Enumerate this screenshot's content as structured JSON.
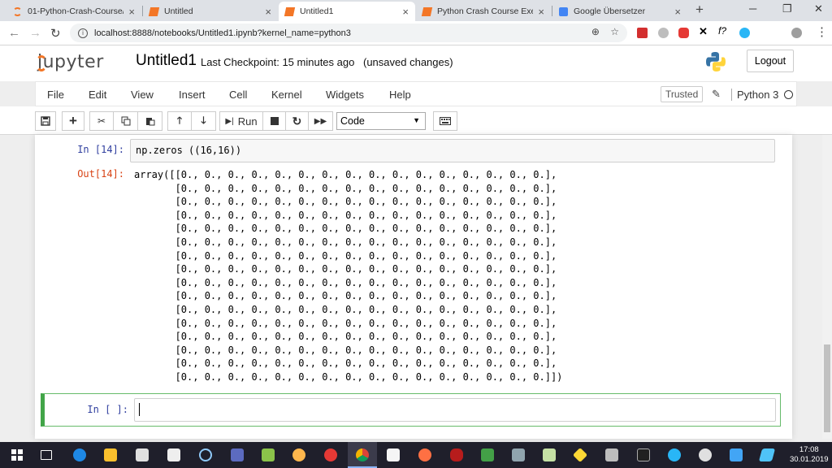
{
  "browser": {
    "tabs": [
      {
        "title": "01-Python-Crash-Course/",
        "close": "×"
      },
      {
        "title": "Untitled",
        "close": "×"
      },
      {
        "title": "Untitled1",
        "close": "×"
      },
      {
        "title": "Python Crash Course Exercis",
        "close": "×"
      },
      {
        "title": "Google Übersetzer",
        "close": "×"
      }
    ],
    "new_tab": "+",
    "url": "localhost:8888/notebooks/Untitled1.ipynb?kernel_name=python3"
  },
  "jupyter": {
    "logo_text": "jupyter",
    "notebook_name": "Untitled1",
    "checkpoint": "Last Checkpoint: 15 minutes ago",
    "unsaved": "(unsaved changes)",
    "logout": "Logout"
  },
  "menu": {
    "items": [
      "File",
      "Edit",
      "View",
      "Insert",
      "Cell",
      "Kernel",
      "Widgets",
      "Help"
    ],
    "trusted": "Trusted",
    "kernel": "Python 3"
  },
  "toolbar": {
    "run_label": "Run",
    "cell_type": "Code"
  },
  "cells": {
    "cell1": {
      "prompt_in": "In [14]:",
      "code": "np.zeros ((16,16))",
      "prompt_out": "Out[14]:",
      "output": "array([[0., 0., 0., 0., 0., 0., 0., 0., 0., 0., 0., 0., 0., 0., 0., 0.],\n       [0., 0., 0., 0., 0., 0., 0., 0., 0., 0., 0., 0., 0., 0., 0., 0.],\n       [0., 0., 0., 0., 0., 0., 0., 0., 0., 0., 0., 0., 0., 0., 0., 0.],\n       [0., 0., 0., 0., 0., 0., 0., 0., 0., 0., 0., 0., 0., 0., 0., 0.],\n       [0., 0., 0., 0., 0., 0., 0., 0., 0., 0., 0., 0., 0., 0., 0., 0.],\n       [0., 0., 0., 0., 0., 0., 0., 0., 0., 0., 0., 0., 0., 0., 0., 0.],\n       [0., 0., 0., 0., 0., 0., 0., 0., 0., 0., 0., 0., 0., 0., 0., 0.],\n       [0., 0., 0., 0., 0., 0., 0., 0., 0., 0., 0., 0., 0., 0., 0., 0.],\n       [0., 0., 0., 0., 0., 0., 0., 0., 0., 0., 0., 0., 0., 0., 0., 0.],\n       [0., 0., 0., 0., 0., 0., 0., 0., 0., 0., 0., 0., 0., 0., 0., 0.],\n       [0., 0., 0., 0., 0., 0., 0., 0., 0., 0., 0., 0., 0., 0., 0., 0.],\n       [0., 0., 0., 0., 0., 0., 0., 0., 0., 0., 0., 0., 0., 0., 0., 0.],\n       [0., 0., 0., 0., 0., 0., 0., 0., 0., 0., 0., 0., 0., 0., 0., 0.],\n       [0., 0., 0., 0., 0., 0., 0., 0., 0., 0., 0., 0., 0., 0., 0., 0.],\n       [0., 0., 0., 0., 0., 0., 0., 0., 0., 0., 0., 0., 0., 0., 0., 0.],\n       [0., 0., 0., 0., 0., 0., 0., 0., 0., 0., 0., 0., 0., 0., 0., 0.]])"
    },
    "cell2": {
      "prompt_in": "In [ ]:",
      "code": ""
    }
  },
  "taskbar": {
    "time": "17:08",
    "date": "30.01.2019"
  },
  "colors": {
    "jupyter_orange": "#f37626",
    "prompt_in": "#303f9f",
    "prompt_out": "#d84315",
    "selected_cell": "#42a548",
    "taskbar_bg": "#1f1f2b"
  },
  "icons": [
    "save-icon",
    "plus-icon",
    "scissors-icon",
    "copy-icon",
    "paste-icon",
    "arrow-up-icon",
    "arrow-down-icon",
    "step-forward-icon",
    "stop-icon",
    "restart-icon",
    "fast-forward-icon",
    "keyboard-icon"
  ]
}
